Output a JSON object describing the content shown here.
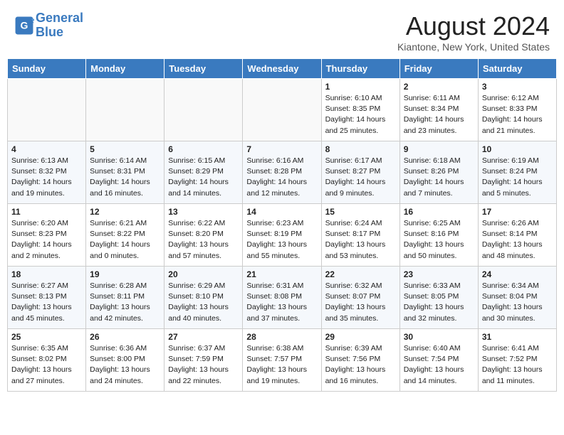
{
  "header": {
    "logo_line1": "General",
    "logo_line2": "Blue",
    "month_year": "August 2024",
    "location": "Kiantone, New York, United States"
  },
  "weekdays": [
    "Sunday",
    "Monday",
    "Tuesday",
    "Wednesday",
    "Thursday",
    "Friday",
    "Saturday"
  ],
  "weeks": [
    [
      {
        "day": "",
        "info": ""
      },
      {
        "day": "",
        "info": ""
      },
      {
        "day": "",
        "info": ""
      },
      {
        "day": "",
        "info": ""
      },
      {
        "day": "1",
        "info": "Sunrise: 6:10 AM\nSunset: 8:35 PM\nDaylight: 14 hours\nand 25 minutes."
      },
      {
        "day": "2",
        "info": "Sunrise: 6:11 AM\nSunset: 8:34 PM\nDaylight: 14 hours\nand 23 minutes."
      },
      {
        "day": "3",
        "info": "Sunrise: 6:12 AM\nSunset: 8:33 PM\nDaylight: 14 hours\nand 21 minutes."
      }
    ],
    [
      {
        "day": "4",
        "info": "Sunrise: 6:13 AM\nSunset: 8:32 PM\nDaylight: 14 hours\nand 19 minutes."
      },
      {
        "day": "5",
        "info": "Sunrise: 6:14 AM\nSunset: 8:31 PM\nDaylight: 14 hours\nand 16 minutes."
      },
      {
        "day": "6",
        "info": "Sunrise: 6:15 AM\nSunset: 8:29 PM\nDaylight: 14 hours\nand 14 minutes."
      },
      {
        "day": "7",
        "info": "Sunrise: 6:16 AM\nSunset: 8:28 PM\nDaylight: 14 hours\nand 12 minutes."
      },
      {
        "day": "8",
        "info": "Sunrise: 6:17 AM\nSunset: 8:27 PM\nDaylight: 14 hours\nand 9 minutes."
      },
      {
        "day": "9",
        "info": "Sunrise: 6:18 AM\nSunset: 8:26 PM\nDaylight: 14 hours\nand 7 minutes."
      },
      {
        "day": "10",
        "info": "Sunrise: 6:19 AM\nSunset: 8:24 PM\nDaylight: 14 hours\nand 5 minutes."
      }
    ],
    [
      {
        "day": "11",
        "info": "Sunrise: 6:20 AM\nSunset: 8:23 PM\nDaylight: 14 hours\nand 2 minutes."
      },
      {
        "day": "12",
        "info": "Sunrise: 6:21 AM\nSunset: 8:22 PM\nDaylight: 14 hours\nand 0 minutes."
      },
      {
        "day": "13",
        "info": "Sunrise: 6:22 AM\nSunset: 8:20 PM\nDaylight: 13 hours\nand 57 minutes."
      },
      {
        "day": "14",
        "info": "Sunrise: 6:23 AM\nSunset: 8:19 PM\nDaylight: 13 hours\nand 55 minutes."
      },
      {
        "day": "15",
        "info": "Sunrise: 6:24 AM\nSunset: 8:17 PM\nDaylight: 13 hours\nand 53 minutes."
      },
      {
        "day": "16",
        "info": "Sunrise: 6:25 AM\nSunset: 8:16 PM\nDaylight: 13 hours\nand 50 minutes."
      },
      {
        "day": "17",
        "info": "Sunrise: 6:26 AM\nSunset: 8:14 PM\nDaylight: 13 hours\nand 48 minutes."
      }
    ],
    [
      {
        "day": "18",
        "info": "Sunrise: 6:27 AM\nSunset: 8:13 PM\nDaylight: 13 hours\nand 45 minutes."
      },
      {
        "day": "19",
        "info": "Sunrise: 6:28 AM\nSunset: 8:11 PM\nDaylight: 13 hours\nand 42 minutes."
      },
      {
        "day": "20",
        "info": "Sunrise: 6:29 AM\nSunset: 8:10 PM\nDaylight: 13 hours\nand 40 minutes."
      },
      {
        "day": "21",
        "info": "Sunrise: 6:31 AM\nSunset: 8:08 PM\nDaylight: 13 hours\nand 37 minutes."
      },
      {
        "day": "22",
        "info": "Sunrise: 6:32 AM\nSunset: 8:07 PM\nDaylight: 13 hours\nand 35 minutes."
      },
      {
        "day": "23",
        "info": "Sunrise: 6:33 AM\nSunset: 8:05 PM\nDaylight: 13 hours\nand 32 minutes."
      },
      {
        "day": "24",
        "info": "Sunrise: 6:34 AM\nSunset: 8:04 PM\nDaylight: 13 hours\nand 30 minutes."
      }
    ],
    [
      {
        "day": "25",
        "info": "Sunrise: 6:35 AM\nSunset: 8:02 PM\nDaylight: 13 hours\nand 27 minutes."
      },
      {
        "day": "26",
        "info": "Sunrise: 6:36 AM\nSunset: 8:00 PM\nDaylight: 13 hours\nand 24 minutes."
      },
      {
        "day": "27",
        "info": "Sunrise: 6:37 AM\nSunset: 7:59 PM\nDaylight: 13 hours\nand 22 minutes."
      },
      {
        "day": "28",
        "info": "Sunrise: 6:38 AM\nSunset: 7:57 PM\nDaylight: 13 hours\nand 19 minutes."
      },
      {
        "day": "29",
        "info": "Sunrise: 6:39 AM\nSunset: 7:56 PM\nDaylight: 13 hours\nand 16 minutes."
      },
      {
        "day": "30",
        "info": "Sunrise: 6:40 AM\nSunset: 7:54 PM\nDaylight: 13 hours\nand 14 minutes."
      },
      {
        "day": "31",
        "info": "Sunrise: 6:41 AM\nSunset: 7:52 PM\nDaylight: 13 hours\nand 11 minutes."
      }
    ]
  ]
}
